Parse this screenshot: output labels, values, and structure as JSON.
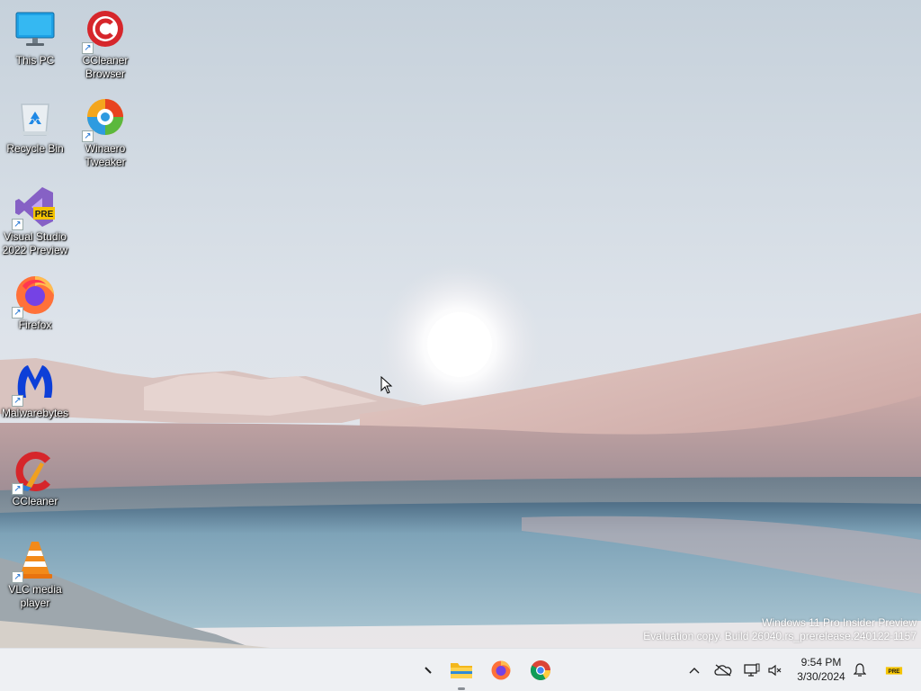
{
  "desktop": {
    "icons": [
      {
        "name": "this-pc",
        "label": "This PC"
      },
      {
        "name": "ccleaner-browser",
        "label": "CCleaner Browser"
      },
      {
        "name": "recycle-bin",
        "label": "Recycle Bin"
      },
      {
        "name": "winaero-tweaker",
        "label": "Winaero Tweaker"
      },
      {
        "name": "visual-studio-2022-preview",
        "label": "Visual Studio 2022 Preview",
        "badge": "PRE"
      },
      {
        "name": "firefox",
        "label": "Firefox"
      },
      {
        "name": "malwarebytes",
        "label": "Malwarebytes"
      },
      {
        "name": "ccleaner",
        "label": "CCleaner"
      },
      {
        "name": "vlc-media-player",
        "label": "VLC media player"
      }
    ],
    "shortcut_glyph": "↗"
  },
  "watermark": {
    "line1": "Windows 11 Pro Insider Preview",
    "line2": "Evaluation copy. Build 26040.rs_prerelease.240122-1157"
  },
  "taskbar": {
    "pinned": [
      {
        "name": "file-explorer",
        "icon": "folder-icon",
        "running": true
      },
      {
        "name": "firefox",
        "icon": "firefox-icon",
        "running": false
      },
      {
        "name": "chrome",
        "icon": "chrome-icon",
        "running": false
      }
    ],
    "tray": {
      "chevron": "^",
      "clock_time": "9:54 PM",
      "clock_date": "3/30/2024",
      "pre_badge": "PRE"
    }
  },
  "colors": {
    "taskbar_bg": "#eef0f3",
    "sky_top": "#c7d2dc",
    "dune": "#d9b9b3",
    "water": "#8fb2c4"
  }
}
